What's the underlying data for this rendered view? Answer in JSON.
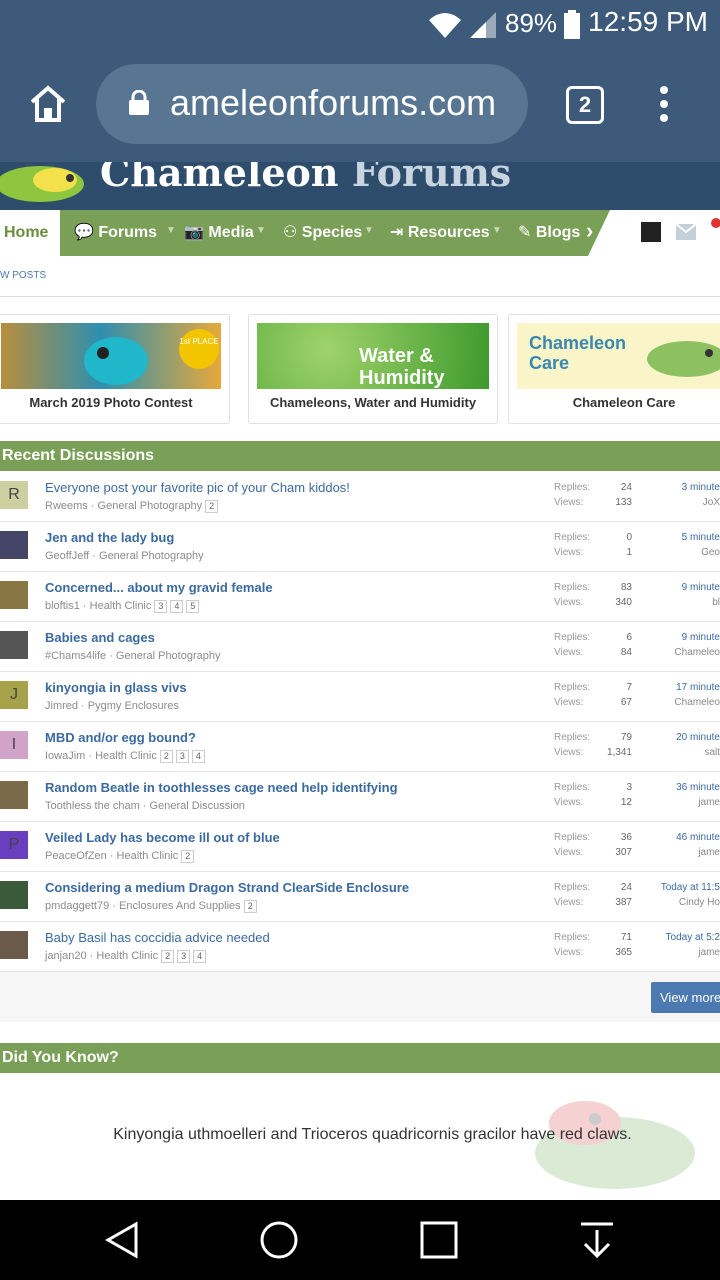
{
  "status": {
    "battery": "89%",
    "time": "12:59 PM"
  },
  "browser": {
    "url": "ameleonforums.com",
    "tab_count": "2"
  },
  "site": {
    "title_a": "Chameleon",
    "title_b": " Forums"
  },
  "nav": {
    "home": "Home",
    "items": [
      "Forums",
      "Media",
      "Species",
      "Resources",
      "Blogs"
    ],
    "subnav": "W POSTS"
  },
  "cards": [
    {
      "caption": "March 2019 Photo Contest",
      "badge": "1st PLACE"
    },
    {
      "caption": "Chameleons, Water and Humidity",
      "overlay": "Water & Humidity"
    },
    {
      "caption": "Chameleon Care",
      "overlay": "Chameleon Care"
    }
  ],
  "recent": {
    "title": "Recent Discussions",
    "labels": {
      "replies": "Replies:",
      "views": "Views:"
    },
    "rows": [
      {
        "avatar": "R",
        "title": "Everyone post your favorite pic of your Cham kiddos!",
        "bold": false,
        "meta": "Rweems · General Photography",
        "pages": [
          "2"
        ],
        "replies": "24",
        "views": "133",
        "time": "3 minute",
        "user": "JoX"
      },
      {
        "avatar": "",
        "title": "Jen and the lady bug",
        "bold": true,
        "meta": "GeoffJeff · General Photography",
        "pages": [],
        "replies": "0",
        "views": "1",
        "time": "5 minute",
        "user": "Geo"
      },
      {
        "avatar": "",
        "title": "Concerned... about my gravid female",
        "bold": true,
        "meta": "bloftis1 · Health Clinic",
        "pages": [
          "3",
          "4",
          "5"
        ],
        "replies": "83",
        "views": "340",
        "time": "9 minute",
        "user": "bl"
      },
      {
        "avatar": "",
        "title": "Babies and cages",
        "bold": true,
        "meta": "#Chams4life · General Photography",
        "pages": [],
        "replies": "6",
        "views": "84",
        "time": "9 minute",
        "user": "Chameleo"
      },
      {
        "avatar": "J",
        "title": "kinyongia in glass vivs",
        "bold": true,
        "meta": "Jimred · Pygmy Enclosures",
        "pages": [],
        "replies": "7",
        "views": "67",
        "time": "17 minute",
        "user": "Chameleo"
      },
      {
        "avatar": "I",
        "title": "MBD and/or egg bound?",
        "bold": true,
        "meta": "IowaJim · Health Clinic",
        "pages": [
          "2",
          "3",
          "4"
        ],
        "replies": "79",
        "views": "1,341",
        "time": "20 minute",
        "user": "salt"
      },
      {
        "avatar": "",
        "title": "Random Beatle in toothlesses cage need help identifying",
        "bold": true,
        "meta": "Toothless the cham · General Discussion",
        "pages": [],
        "replies": "3",
        "views": "12",
        "time": "36 minute",
        "user": "jame"
      },
      {
        "avatar": "P",
        "title": "Veiled Lady has become ill out of blue",
        "bold": true,
        "meta": "PeaceOfZen · Health Clinic",
        "pages": [
          "2"
        ],
        "replies": "36",
        "views": "307",
        "time": "46 minute",
        "user": "jame"
      },
      {
        "avatar": "",
        "title": "Considering a medium Dragon Strand ClearSide Enclosure",
        "bold": true,
        "meta": "pmdaggett79 · Enclosures And Supplies",
        "pages": [
          "2"
        ],
        "replies": "24",
        "views": "387",
        "time": "Today at 11:5",
        "user": "Cindy Ho"
      },
      {
        "avatar": "",
        "title": "Baby Basil has coccidia advice needed",
        "bold": false,
        "meta": "janjan20 · Health Clinic",
        "pages": [
          "2",
          "3",
          "4"
        ],
        "replies": "71",
        "views": "365",
        "time": "Today at 5:2",
        "user": "jame"
      }
    ],
    "view_more": "View more"
  },
  "did_you_know": {
    "title": "Did You Know?",
    "fact": "Kinyongia uthmoelleri and Trioceros quadricornis gracilor have red claws."
  },
  "colors": {
    "green": "#7a9f57",
    "blue": "#3d5a7a",
    "link": "#3a6aa0"
  }
}
